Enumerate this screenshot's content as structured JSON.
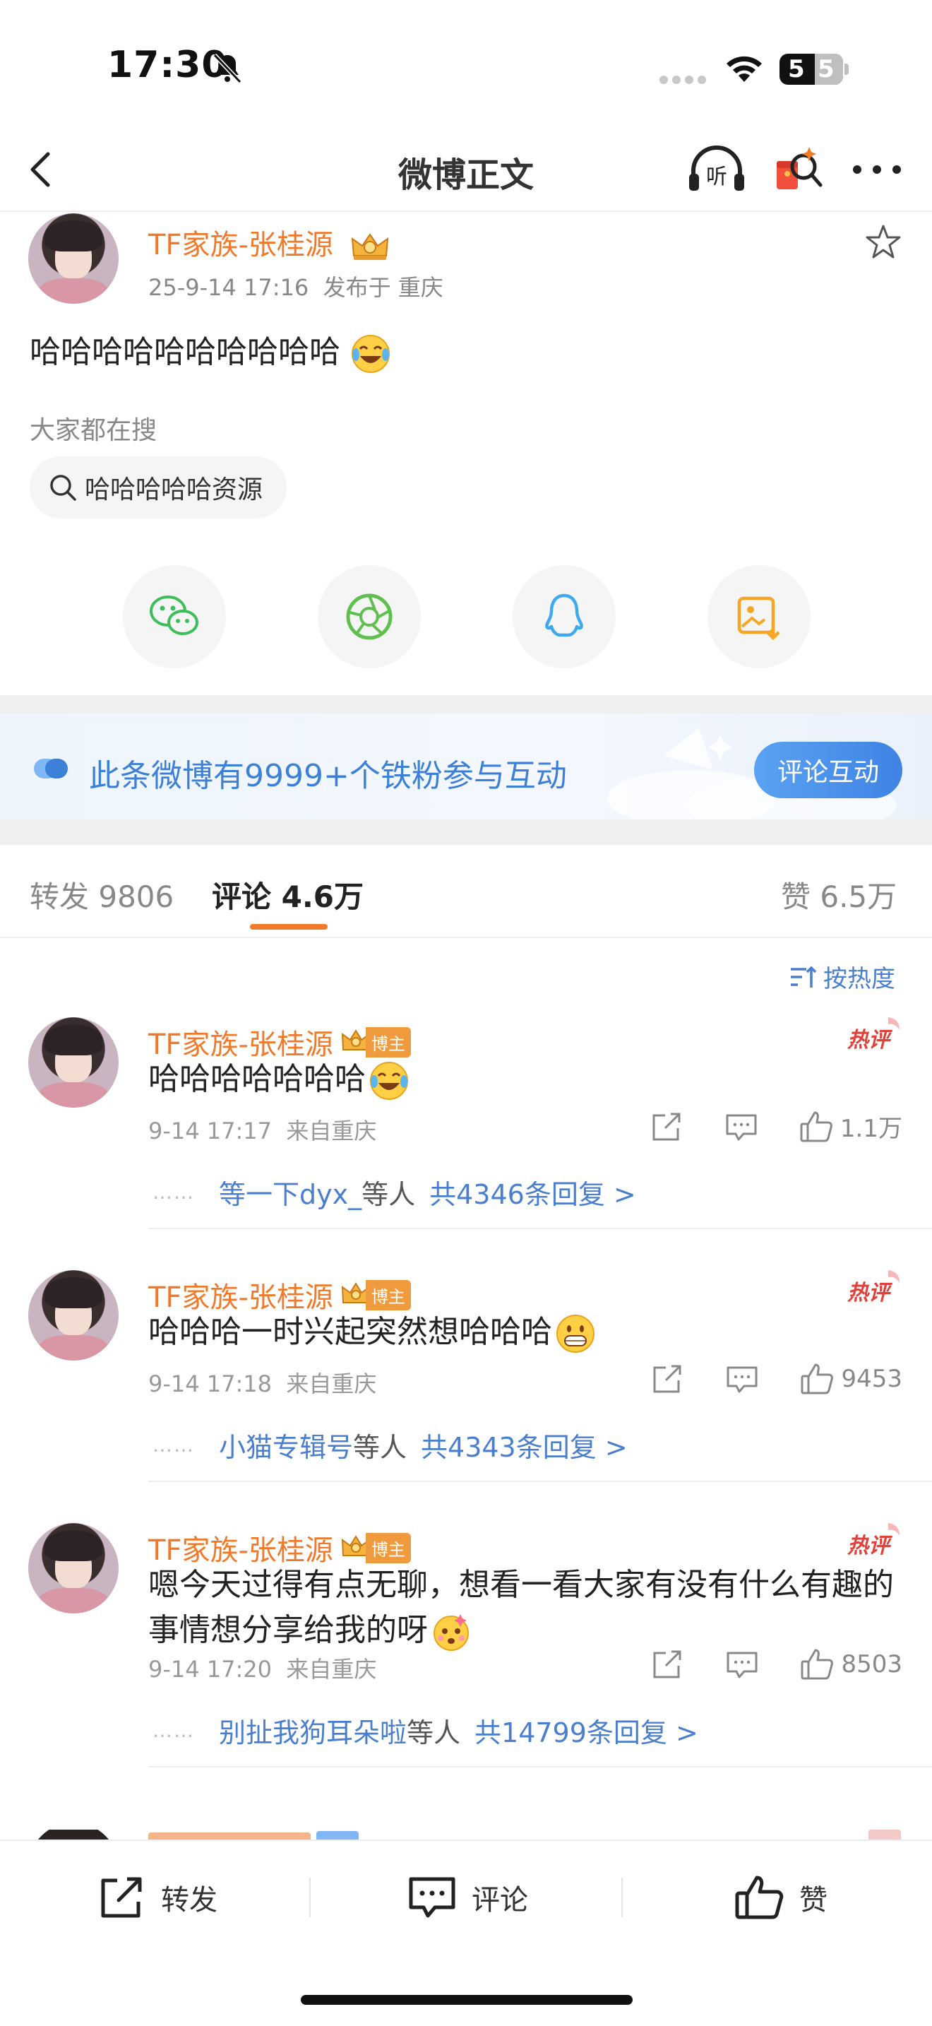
{
  "status_bar": {
    "time": "17:30",
    "battery": "55",
    "battery_lead": "5",
    "battery_tail": "5"
  },
  "nav": {
    "title": "微博正文",
    "listen_label": "听"
  },
  "post": {
    "author": "TF家族-张桂源",
    "date": "25-9-14 17:16",
    "location": "发布于 重庆",
    "text": "哈哈哈哈哈哈哈哈哈哈",
    "hot_search_title": "大家都在搜",
    "hot_search_chip": "哈哈哈哈哈资源"
  },
  "share": {
    "items": [
      "wechat-icon",
      "moments-icon",
      "qq-icon",
      "save-image-icon"
    ]
  },
  "fan_banner": {
    "text": "此条微博有9999+个铁粉参与互动",
    "button": "评论互动"
  },
  "tabs": {
    "repost": "转发 9806",
    "comment": "评论 4.6万",
    "like": "赞 6.5万"
  },
  "sort_label": "按热度",
  "comments": [
    {
      "author": "TF家族-张桂源",
      "badge": "博主",
      "hot": "热评",
      "text": "哈哈哈哈哈哈哈",
      "time": "9-14 17:17",
      "location": "来自重庆",
      "likes": "1.1万",
      "reply_names": "等一下dyx_",
      "reply_mid": "等人",
      "reply_count": "共4346条回复 >"
    },
    {
      "author": "TF家族-张桂源",
      "badge": "博主",
      "hot": "热评",
      "text": "哈哈哈一时兴起突然想哈哈哈",
      "time": "9-14 17:18",
      "location": "来自重庆",
      "likes": "9453",
      "reply_names": "小猫专辑号",
      "reply_mid": "等人",
      "reply_count": "共4343条回复 >"
    },
    {
      "author": "TF家族-张桂源",
      "badge": "博主",
      "hot": "热评",
      "text": "嗯今天过得有点无聊，想看一看大家有没有什么有趣的事情想分享给我的呀",
      "time": "9-14 17:20",
      "location": "来自重庆",
      "likes": "8503",
      "reply_names": "别扯我狗耳朵啦",
      "reply_mid": "等人",
      "reply_count": "共14799条回复 >"
    }
  ],
  "bottom_bar": {
    "repost": "转发",
    "comment": "评论",
    "like": "赞"
  },
  "colors": {
    "accent_orange": "#f07a2a",
    "link_blue": "#4a7fd0",
    "banner_blue": "#3d80d8"
  }
}
